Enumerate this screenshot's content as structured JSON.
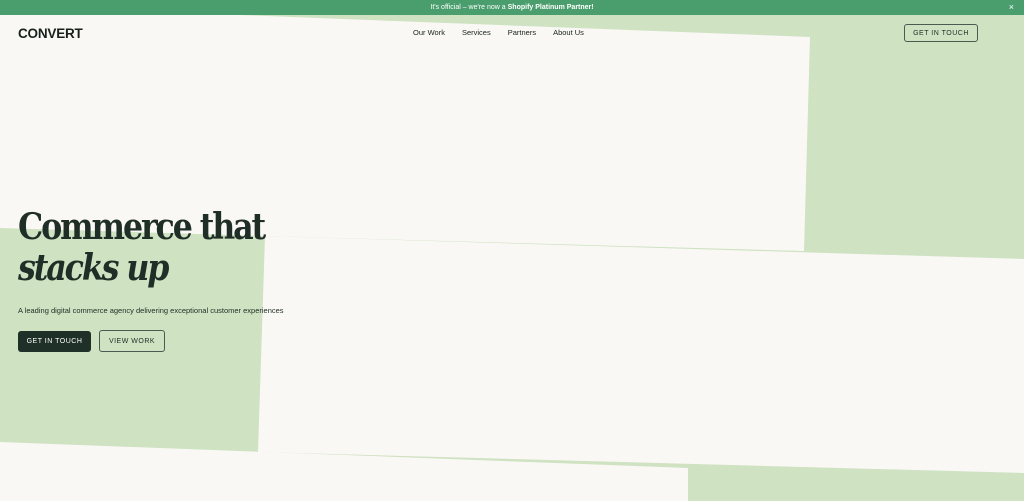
{
  "announcement": {
    "text_prefix": "It's official – we're now a ",
    "text_bold": "Shopify Platinum Partner!",
    "close_icon": "×"
  },
  "header": {
    "logo": "CONVERT",
    "nav": [
      "Our Work",
      "Services",
      "Partners",
      "About Us"
    ],
    "cta": "GET IN TOUCH"
  },
  "hero": {
    "title_line1": "Commerce that",
    "title_line2": "stacks up",
    "subtitle": "A leading digital commerce agency delivering exceptional customer experiences",
    "primary_button": "GET IN TOUCH",
    "secondary_button": "VIEW WORK"
  },
  "colors": {
    "announce_bg": "#4a9e6d",
    "page_green": "#cfe2c2",
    "panel": "#faf8f5",
    "dark": "#1f3028"
  }
}
